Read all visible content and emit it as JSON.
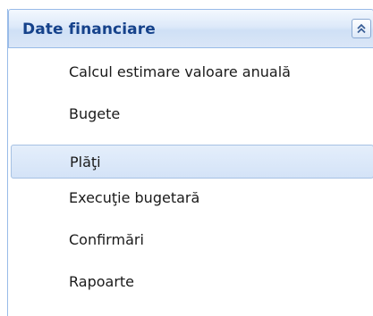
{
  "panel": {
    "title": "Date financiare",
    "collapse_icon": "double-chevron-up-icon",
    "header_text_color": "#15428b",
    "border_color": "#99bbe8"
  },
  "menu": {
    "items": [
      {
        "label": "Calcul estimare valoare anuală",
        "selected": false
      },
      {
        "label": "Bugete",
        "selected": false
      },
      {
        "label": "Plăţi",
        "selected": true
      },
      {
        "label": "Execuţie bugetară",
        "selected": false
      },
      {
        "label": "Confirmări",
        "selected": false
      },
      {
        "label": "Rapoarte",
        "selected": false
      }
    ]
  }
}
